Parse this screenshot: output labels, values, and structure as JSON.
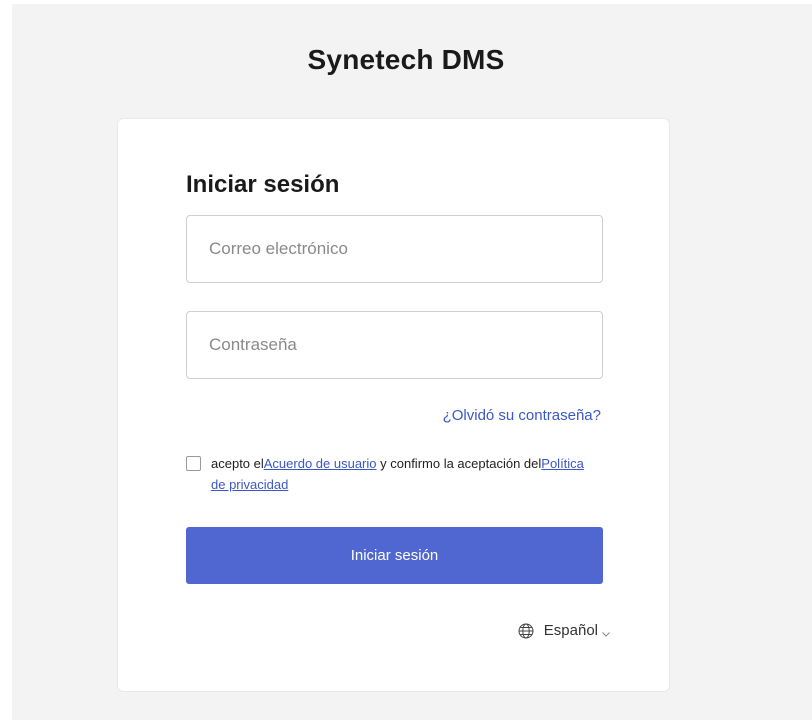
{
  "app": {
    "title": "Synetech DMS"
  },
  "login": {
    "heading": "Iniciar sesión",
    "email_placeholder": "Correo electrónico",
    "password_placeholder": "Contraseña",
    "forgot_password": "¿Olvidó su contraseña?",
    "consent": {
      "prefix": "acepto el",
      "user_agreement": "Acuerdo de usuario",
      "middle": " y confirmo la aceptación del",
      "privacy_policy": "Política de privacidad"
    },
    "submit_label": "Iniciar sesión"
  },
  "language": {
    "selected": "Español",
    "icon": "globe-icon"
  },
  "colors": {
    "page_background": "#f3f3f3",
    "card_background": "#ffffff",
    "accent": "#5066d0",
    "link": "#3a57c8"
  }
}
